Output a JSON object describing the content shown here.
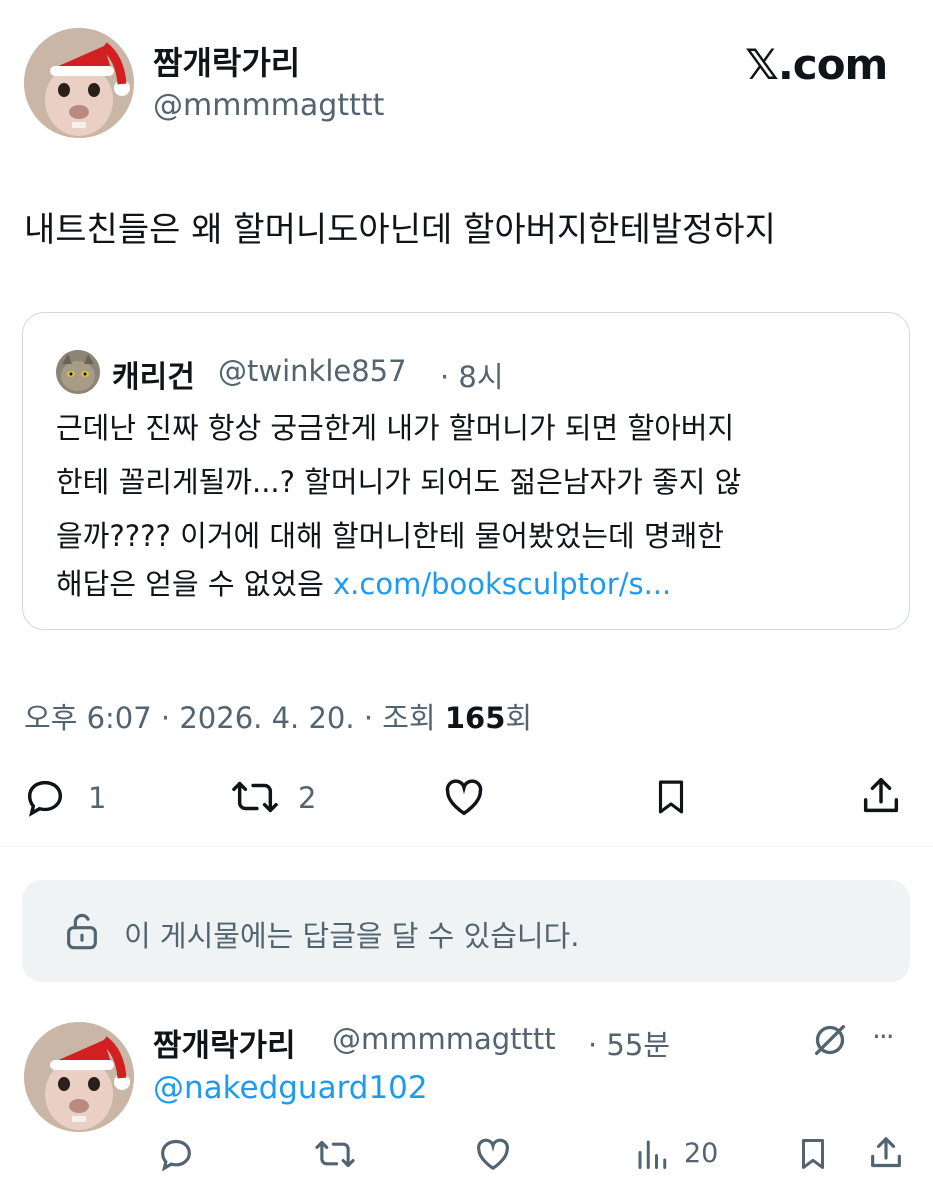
{
  "header": {
    "display_name": "짬개락가리",
    "handle": "@mmmmagtttt",
    "brand": "𝕏.com"
  },
  "tweet": {
    "text": "내트친들은 왜 할머니도아닌데 할아버지한테발정하지",
    "meta": {
      "time": "오후 6:07 · 2026. 4. 20. · 조회 ",
      "views": "165",
      "views_suffix": "회"
    },
    "actions": {
      "reply_count": "1",
      "retweet_count": "2"
    }
  },
  "quote": {
    "name": "캐리건",
    "handle": "@twinkle857",
    "time": "· 8시",
    "lines": [
      "근데난 진짜 항상 궁금한게 내가 할머니가 되면 할아버지",
      "한테 꼴리게될까...? 할머니가 되어도 젊은남자가 좋지 않",
      "을까???? 이거에 대해 할머니한테 물어봤었는데 명쾌한",
      "해답은 얻을 수 없었음 "
    ],
    "link": "x.com/booksculptor/s..."
  },
  "reply_restriction": {
    "text": "이 게시물에는 답글을 달 수 있습니다."
  },
  "reply": {
    "display_name": "짬개락가리",
    "handle": "@mmmmagtttt",
    "time": "· 55분",
    "mention": "@nakedguard102",
    "views_count": "20",
    "more": "···"
  },
  "colors": {
    "text": "#0f1419",
    "muted": "#536471",
    "link": "#1d9bf0",
    "border": "#cfd9de",
    "banner_bg": "#eff3f4"
  },
  "icons": [
    "reply-icon",
    "retweet-icon",
    "like-icon",
    "bookmark-icon",
    "share-icon",
    "lock-icon",
    "grok-icon",
    "views-icon",
    "more-icon"
  ]
}
